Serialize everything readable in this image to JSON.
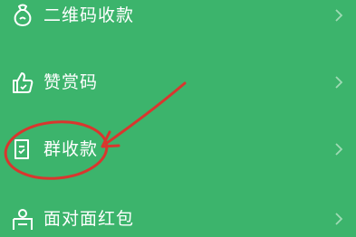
{
  "menu": {
    "items": [
      {
        "label": "二维码收款",
        "icon": "money-bag-icon"
      },
      {
        "label": "赞赏码",
        "icon": "thumbs-up-icon"
      },
      {
        "label": "群收款",
        "icon": "group-receipt-icon"
      },
      {
        "label": "面对面红包",
        "icon": "red-packet-icon"
      }
    ]
  },
  "colors": {
    "background": "#3cb46c",
    "text": "#ffffff",
    "chevron": "#9fdbb5",
    "annotation": "#d9362e"
  },
  "annotation": {
    "type": "red circle with arrow",
    "target": "群收款"
  }
}
